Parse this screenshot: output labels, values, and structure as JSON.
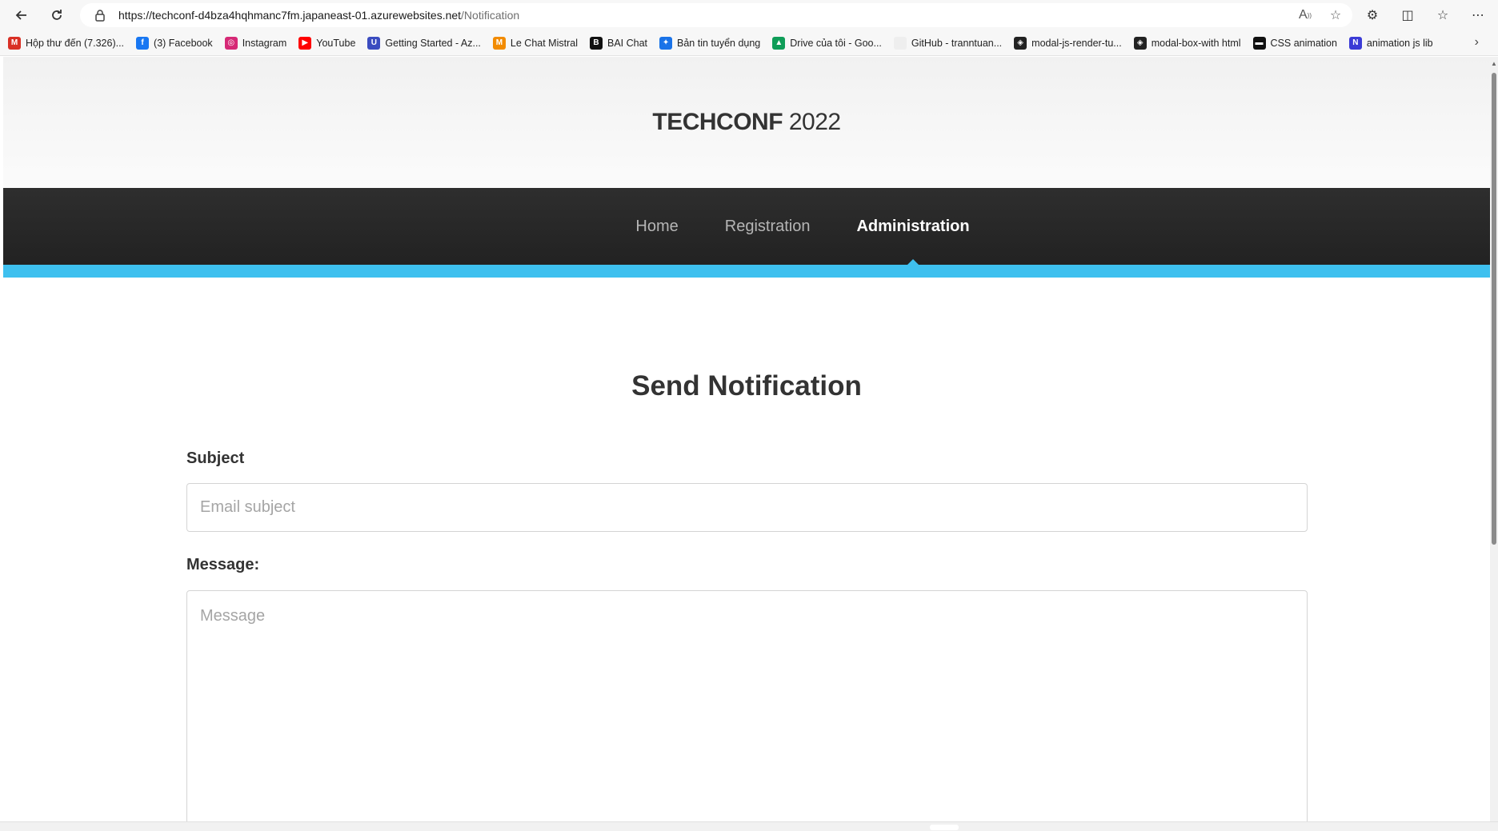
{
  "browser": {
    "url_host": "https://techconf-d4bza4hqhmanc7fm.japaneast-01.azurewebsites.net",
    "url_path": "/Notification",
    "bookmarks": [
      {
        "label": "Hộp thư đến (7.326)...",
        "icon": "gmail-icon",
        "color": "#d93025",
        "glyph": "M"
      },
      {
        "label": "(3) Facebook",
        "icon": "facebook-icon",
        "color": "#1877f2",
        "glyph": "f"
      },
      {
        "label": "Instagram",
        "icon": "instagram-icon",
        "color": "#d62976",
        "glyph": "◎"
      },
      {
        "label": "YouTube",
        "icon": "youtube-icon",
        "color": "#ff0000",
        "glyph": "▶"
      },
      {
        "label": "Getting Started - Az...",
        "icon": "azure-icon",
        "color": "#3b4cc0",
        "glyph": "U"
      },
      {
        "label": "Le Chat Mistral",
        "icon": "mistral-icon",
        "color": "#f28b00",
        "glyph": "M"
      },
      {
        "label": "BAI Chat",
        "icon": "baichat-icon",
        "color": "#111111",
        "glyph": "B"
      },
      {
        "label": "Bản tin tuyển dụng",
        "icon": "jobs-icon",
        "color": "#1a73e8",
        "glyph": "✦"
      },
      {
        "label": "Drive của tôi - Goo...",
        "icon": "google-drive-icon",
        "color": "#0f9d58",
        "glyph": "▲"
      },
      {
        "label": "GitHub - tranntuan...",
        "icon": "github-icon",
        "color": "#eeeeee",
        "glyph": ""
      },
      {
        "label": "modal-js-render-tu...",
        "icon": "codepen-icon",
        "color": "#222222",
        "glyph": "◈"
      },
      {
        "label": "modal-box-with html",
        "icon": "codepen-icon",
        "color": "#222222",
        "glyph": "◈"
      },
      {
        "label": "CSS animation",
        "icon": "css-animation-icon",
        "color": "#111111",
        "glyph": "▬"
      },
      {
        "label": "animation js lib",
        "icon": "animation-lib-icon",
        "color": "#3b3bd6",
        "glyph": "N"
      }
    ]
  },
  "site": {
    "brand_bold": "TECHCONF",
    "brand_year": " 2022",
    "nav": [
      {
        "label": "Home",
        "active": false
      },
      {
        "label": "Registration",
        "active": false
      },
      {
        "label": "Administration",
        "active": true
      }
    ],
    "accent_color": "#3ec0ef"
  },
  "form": {
    "title": "Send Notification",
    "subject_label": "Subject",
    "subject_placeholder": "Email subject",
    "message_label": "Message:",
    "message_placeholder": "Message"
  }
}
